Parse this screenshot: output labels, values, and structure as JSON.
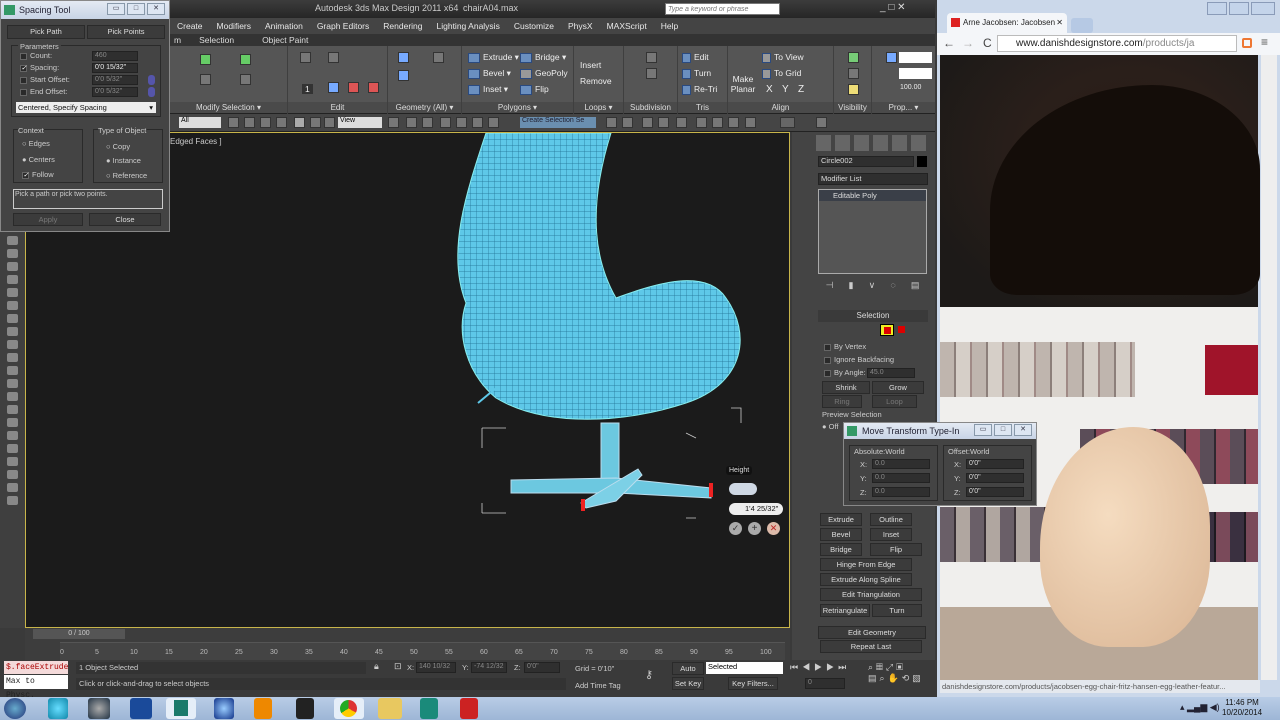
{
  "max": {
    "title": "Autodesk 3ds Max Design 2011 x64",
    "file": "chairA04.max",
    "search_placeholder": "Type a keyword or phrase",
    "menu": [
      "Create",
      "Modifiers",
      "Animation",
      "Graph Editors",
      "Rendering",
      "Lighting Analysis",
      "Customize",
      "PhysX",
      "MAXScript",
      "Help"
    ],
    "ribbon_tabs": [
      "m",
      "Selection",
      "Object Paint"
    ],
    "ribbon": {
      "groups": [
        "Modify Selection ▾",
        "Edit",
        "Geometry (All) ▾",
        "Polygons ▾",
        "Loops ▾",
        "Subdivision",
        "Tris",
        "Align",
        "Visibility",
        "Prop... ▾"
      ],
      "polygons": [
        "Extrude",
        "Bevel",
        "Inset",
        "Bridge",
        "GeoPoly",
        "Flip"
      ],
      "loops": [
        "Insert",
        "Remove"
      ],
      "tris": [
        "Edit",
        "Turn",
        "Re-Tri"
      ],
      "make_planar": "Make Planar",
      "align": [
        "To View",
        "To Grid"
      ],
      "xyz": [
        "X",
        "Y",
        "Z"
      ],
      "edit_spinner": "1",
      "opacity": "100.00"
    },
    "toolbar": {
      "filter": "All",
      "coord": "View",
      "selection_set": "Create Selection Se"
    },
    "viewport_label": "Edged Faces ]",
    "caddy": {
      "tooltip": "Height",
      "value": "1'4 25/32\""
    },
    "command_panel": {
      "object_name": "Circle002",
      "modifier_list": "Modifier List",
      "stack": [
        "Editable Poly"
      ],
      "selection_title": "Selection",
      "by_vertex": "By Vertex",
      "ignore_backfacing": "Ignore Backfacing",
      "by_angle": "By Angle:",
      "angle_value": "45.0",
      "shrink": "Shrink",
      "grow": "Grow",
      "ring": "Ring",
      "loop": "Loop",
      "preview_selection": "Preview Selection",
      "off": "Off",
      "poly_buttons": [
        [
          "Extrude",
          "Outline"
        ],
        [
          "Bevel",
          "Inset"
        ],
        [
          "Bridge",
          "Flip"
        ]
      ],
      "hinge": "Hinge From Edge",
      "extrude_spline": "Extrude Along Spline",
      "edit_tri": "Edit Triangulation",
      "retri": "Retriangulate",
      "turn": "Turn",
      "edit_geometry": "Edit Geometry",
      "repeat_last": "Repeat Last"
    },
    "timeline": {
      "slider": "0 / 100",
      "ticks": [
        "0",
        "5",
        "10",
        "15",
        "20",
        "25",
        "30",
        "35",
        "40",
        "45",
        "50",
        "55",
        "60",
        "65",
        "70",
        "75",
        "80",
        "85",
        "90",
        "95",
        "100"
      ]
    },
    "status": {
      "script1": "$.faceExtrude",
      "script2": "Max to Physc.",
      "selected": "1 Object Selected",
      "prompt": "Click or click-and-drag to select objects",
      "x_label": "X:",
      "x": "140 10/32",
      "y_label": "Y:",
      "y": "-74 12/32",
      "z_label": "Z:",
      "z": "0'0\"",
      "grid": "Grid = 0'10\"",
      "add_time_tag": "Add Time Tag",
      "auto_key": "Auto Key",
      "set_key": "Set Key",
      "key_mode": "Selected",
      "key_filters": "Key Filters...",
      "frame": "0"
    }
  },
  "spacing_tool": {
    "title": "Spacing Tool",
    "pick_path": "Pick Path",
    "pick_points": "Pick Points",
    "parameters": "Parameters",
    "count_label": "Count:",
    "count": "460",
    "spacing_label": "Spacing:",
    "spacing": "0'0 15/32\"",
    "start_label": "Start Offset:",
    "start": "0'0 5/32\"",
    "end_label": "End Offset:",
    "end": "0'0 5/32\"",
    "mode": "Centered, Specify Spacing",
    "context": "Context",
    "edges": "Edges",
    "centers": "Centers",
    "follow": "Follow",
    "type_of_object": "Type of Object",
    "copy": "Copy",
    "instance": "Instance",
    "reference": "Reference",
    "message": "Pick a path or pick two points.",
    "apply": "Apply",
    "close": "Close"
  },
  "move_typein": {
    "title": "Move Transform Type-In",
    "absolute": "Absolute:World",
    "offset": "Offset:World",
    "abs_values": [
      [
        "X:",
        "0.0"
      ],
      [
        "Y:",
        "0.0"
      ],
      [
        "Z:",
        "0.0"
      ]
    ],
    "off_values": [
      [
        "X:",
        "0'0\""
      ],
      [
        "Y:",
        "0'0\""
      ],
      [
        "Z:",
        "0'0\""
      ]
    ]
  },
  "chrome": {
    "tab": "Arne Jacobsen: Jacobsen",
    "url_domain": "www.danishdesignstore.com",
    "url_path": "/products/ja",
    "status_url": "danishdesignstore.com/products/jacobsen-egg-chair-fritz-hansen-egg-leather-featur..."
  },
  "taskbar": {
    "time": "11:46 PM",
    "date": "10/20/2014"
  }
}
